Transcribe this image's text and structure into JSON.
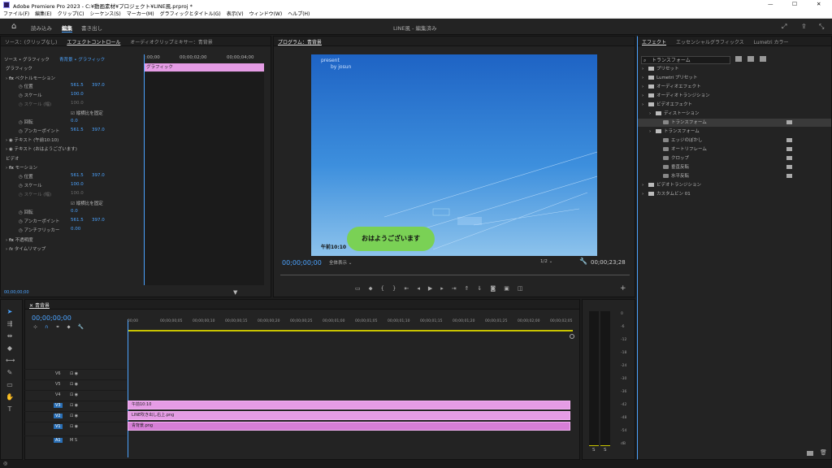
{
  "window": {
    "title": "Adobe Premiere Pro 2023 - C:¥動画素材¥プロジェクト¥LINE風.prproj *"
  },
  "menu": [
    "ファイル(F)",
    "編集(E)",
    "クリップ(C)",
    "シーケンス(S)",
    "マーカー(M)",
    "グラフィックとタイトル(G)",
    "表示(V)",
    "ウィンドウ(W)",
    "ヘルプ(H)"
  ],
  "header": {
    "tabs": [
      "読み込み",
      "編集",
      "書き出し"
    ],
    "center": "LINE風 - 編集済み"
  },
  "effect_controls": {
    "tabs": [
      "ソース：(クリップなし)",
      "エフェクトコントロール",
      "オーディオクリップミキサー：青背景"
    ],
    "source": "ソース • グラフィック",
    "target": "青背景 • グラフィック",
    "timeline_times": [
      ":00;00",
      "00;00;02;00",
      "00;00;04;00"
    ],
    "clip_label": "グラフィック",
    "section_graphic": "グラフィック",
    "section_video": "ビデオ",
    "vector_motion": "ベクトルモーション",
    "motion": "モーション",
    "position": "位置",
    "scale": "スケール",
    "scale_width": "スケール (幅)",
    "uniform_scale": "縦横比を固定",
    "rotation": "回転",
    "anchor": "アンカーポイント",
    "antiflicker": "アンチフリッカー",
    "text1": "テキスト (午前10:10)",
    "text2": "テキスト (おはようございます)",
    "opacity": "不透明度",
    "time_remap": "タイムリマップ",
    "pos_x": "561.5",
    "pos_y": "397.0",
    "scale_val": "100.0",
    "scale_w_val": "100.0",
    "rot_val": "0.0",
    "anchor_x": "561.5",
    "anchor_y": "397.0",
    "flicker_val": "0.00",
    "current_time": "00;00;00;00"
  },
  "program": {
    "tab": "プログラム：青背景",
    "overlay_line1": "present",
    "overlay_line2": "by josun",
    "bubble": "おはようございます",
    "time_label": "午前10:10",
    "timecode": "00;00;00;00",
    "fit": "全体表示",
    "quality": "1/2",
    "duration": "00;00;23;28"
  },
  "timeline": {
    "tab": "青背景",
    "timecode": "00;00;00;00",
    "ruler": [
      "00;00",
      "00;00;00;05",
      "00;00;00;10",
      "00;00;00;15",
      "00;00;00;20",
      "00;00;00;25",
      "00;00;01;00",
      "00;00;01;05",
      "00;00;01;10",
      "00;00;01;15",
      "00;00;01;20",
      "00;00;01;25",
      "00;00;02;00",
      "00;00;02;05"
    ],
    "tracks": [
      "V6",
      "V5",
      "V4",
      "V3",
      "V2",
      "V1",
      "A1"
    ],
    "clips": [
      {
        "label": "午前10:10",
        "color": "#e59ce5"
      },
      {
        "label": "LINE吹き出し右上.png",
        "color": "#e59ce5"
      },
      {
        "label": "青背景.png",
        "color": "#d77fd7"
      }
    ],
    "track_letters": [
      "M",
      "S"
    ]
  },
  "meter": {
    "ticks": [
      "0",
      "-6",
      "-12",
      "-18",
      "-24",
      "-30",
      "-36",
      "-42",
      "-48",
      "-54",
      "dB"
    ],
    "solo": [
      "S",
      "S"
    ]
  },
  "effects_panel": {
    "tabs": [
      "エフェクト",
      "エッセンシャルグラフィックス",
      "Lumetri カラー"
    ],
    "search": "トランスフォーム",
    "items": [
      {
        "label": "プリセット",
        "level": 0,
        "type": "folder"
      },
      {
        "label": "Lumetri プリセット",
        "level": 0,
        "type": "folder"
      },
      {
        "label": "オーディオエフェクト",
        "level": 0,
        "type": "folder"
      },
      {
        "label": "オーディオトランジション",
        "level": 0,
        "type": "folder"
      },
      {
        "label": "ビデオエフェクト",
        "level": 0,
        "type": "folder"
      },
      {
        "label": "ディストーション",
        "level": 1,
        "type": "folder"
      },
      {
        "label": "トランスフォーム",
        "level": 2,
        "type": "effect",
        "selected": true
      },
      {
        "label": "トランスフォーム",
        "level": 1,
        "type": "folder"
      },
      {
        "label": "エッジのぼかし",
        "level": 2,
        "type": "effect"
      },
      {
        "label": "オートリフレーム",
        "level": 2,
        "type": "effect"
      },
      {
        "label": "クロップ",
        "level": 2,
        "type": "effect"
      },
      {
        "label": "垂直反転",
        "level": 2,
        "type": "effect"
      },
      {
        "label": "水平反転",
        "level": 2,
        "type": "effect"
      },
      {
        "label": "ビデオトランジション",
        "level": 0,
        "type": "folder"
      },
      {
        "label": "カスタムビン 01",
        "level": 0,
        "type": "folder"
      }
    ]
  },
  "colors": {
    "accent": "#4ba3ff",
    "clip_pink": "#e59ce5",
    "bubble_green": "#7ad155",
    "panel": "#232323"
  }
}
